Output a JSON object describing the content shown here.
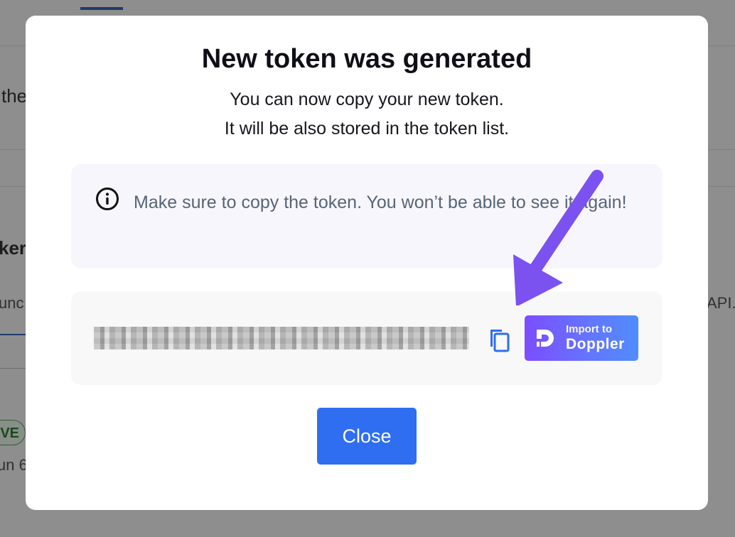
{
  "background": {
    "fragment_text_1": "the",
    "fragment_text_2": "ker",
    "fragment_text_3": "unc",
    "fragment_text_4": "API.",
    "status_badge": "VE",
    "date_fragment": "un 6"
  },
  "modal": {
    "title": "New token was generated",
    "subtitle_line1": "You can now copy your new token.",
    "subtitle_line2": "It will be also stored in the token list.",
    "info_icon": "info-circle-icon",
    "info_text": "Make sure to copy the token. You won’t be able to see it again!",
    "token_masked": true,
    "copy_icon": "copy-icon",
    "doppler": {
      "small_label": "Import to",
      "big_label": "Doppler",
      "logo_icon": "doppler-logo-icon"
    },
    "close_label": "Close"
  },
  "annotation": {
    "arrow_icon": "arrow-down-left-icon",
    "arrow_color": "#7b52f0"
  },
  "colors": {
    "close_button": "#2f6ef0",
    "info_box_bg": "#f8f6fd",
    "token_box_bg": "#f8f8f8"
  }
}
